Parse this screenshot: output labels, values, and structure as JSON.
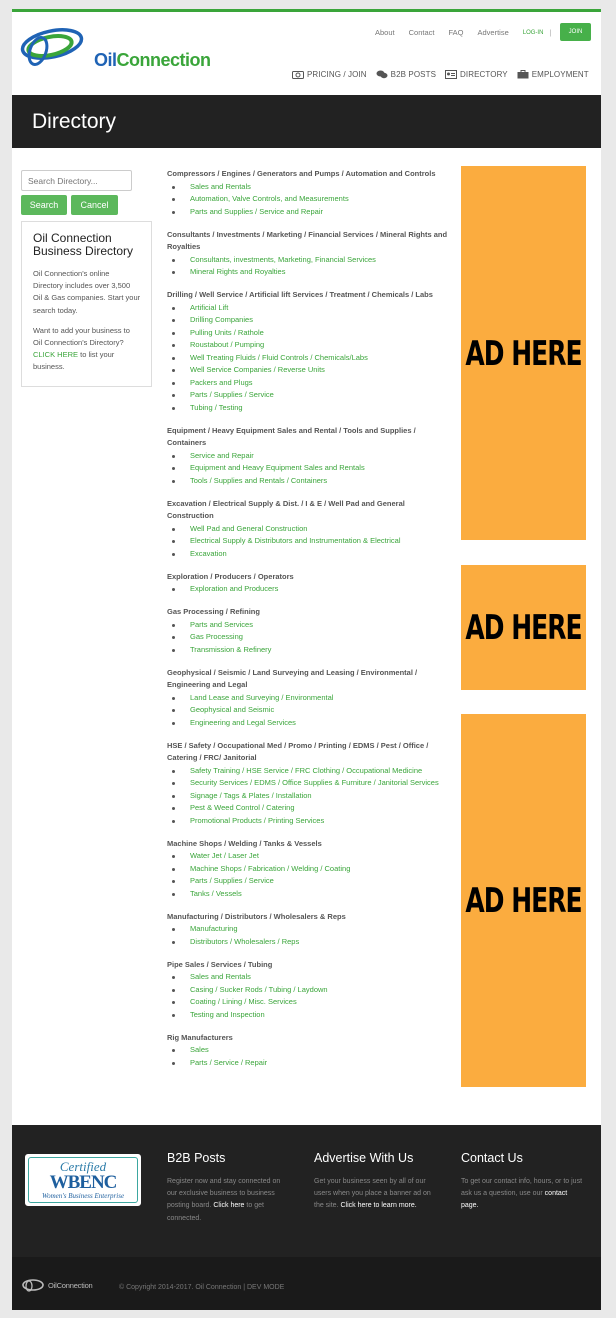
{
  "brand": {
    "logo_oil": "Oil",
    "logo_connection": "Connection",
    "brand_green": "#3aa53a",
    "brand_blue": "#1f63b5"
  },
  "topnav": {
    "about": "About",
    "contact": "Contact",
    "faq": "FAQ",
    "advertise": "Advertise",
    "login": "LOG-IN",
    "sep": "|",
    "join": "JOIN"
  },
  "mainnav": [
    {
      "label": "PRICING / JOIN",
      "icon": "camera-icon"
    },
    {
      "label": "B2B POSTS",
      "icon": "chat-icon"
    },
    {
      "label": "DIRECTORY",
      "icon": "id-card-icon"
    },
    {
      "label": "EMPLOYMENT",
      "icon": "briefcase-icon"
    }
  ],
  "page_title": "Directory",
  "search": {
    "placeholder": "Search Directory...",
    "search_label": "Search",
    "cancel_label": "Cancel"
  },
  "infobox": {
    "title": "Oil Connection Business Directory",
    "p1": "Oil Connection's online Directory includes over 3,500 Oil & Gas companies. Start your search today.",
    "p2_before": "Want to add your business to Oil Connection's Directory?",
    "p2_link": "CLICK HERE",
    "p2_after": "to list your business."
  },
  "categories": [
    {
      "title": "Compressors / Engines / Generators and Pumps / Automation and Controls",
      "items": [
        "Sales and Rentals",
        "Automation, Valve Controls, and Measurements",
        "Parts and Supplies / Service and Repair"
      ]
    },
    {
      "title": "Consultants / Investments / Marketing / Financial Services / Mineral Rights and Royalties",
      "items": [
        "Consultants, investments, Marketing, Financial Services",
        "Mineral Rights and Royalties"
      ]
    },
    {
      "title": "Drilling / Well Service / Artificial lift Services / Treatment / Chemicals / Labs",
      "items": [
        "Artificial Lift",
        "Drilling Companies",
        "Pulling Units / Rathole",
        "Roustabout / Pumping",
        "Well Treating Fluids / Fluid Controls / Chemicals/Labs",
        "Well Service Companies / Reverse Units",
        "Packers and Plugs",
        "Parts / Supplies / Service",
        "Tubing / Testing"
      ]
    },
    {
      "title": "Equipment / Heavy Equipment Sales and Rental / Tools and Supplies / Containers",
      "items": [
        "Service and Repair",
        "Equipment and Heavy Equipment Sales and Rentals",
        "Tools / Supplies and Rentals / Containers"
      ]
    },
    {
      "title": "Excavation / Electrical Supply & Dist. / I & E / Well Pad and General Construction",
      "items": [
        "Well Pad and General Construction",
        "Electrical Supply & Distributors and Instrumentation & Electrical",
        "Excavation"
      ]
    },
    {
      "title": "Exploration / Producers / Operators",
      "items": [
        "Exploration and Producers"
      ]
    },
    {
      "title": "Gas Processing / Refining",
      "items": [
        "Parts and Services",
        "Gas Processing",
        "Transmission & Refinery"
      ]
    },
    {
      "title": "Geophysical / Seismic / Land Surveying and Leasing / Environmental / Engineering and Legal",
      "items": [
        "Land Lease and Surveying / Environmental",
        "Geophysical and Seismic",
        "Engineering and Legal Services"
      ]
    },
    {
      "title": "HSE / Safety / Occupational Med / Promo / Printing / EDMS / Pest / Office / Catering / FRC/ Janitorial",
      "items": [
        "Safety Training / HSE Service / FRC Clothing / Occupational Medicine",
        "Security Services / EDMS / Office Supplies & Furniture / Janitorial Services",
        "Signage / Tags & Plates / Installation",
        "Pest & Weed Control / Catering",
        "Promotional Products / Printing Services"
      ]
    },
    {
      "title": "Machine Shops / Welding / Tanks & Vessels",
      "items": [
        "Water Jet / Laser Jet",
        "Machine Shops / Fabrication / Welding / Coating",
        "Parts / Supplies / Service",
        "Tanks / Vessels"
      ]
    },
    {
      "title": "Manufacturing / Distributors / Wholesalers & Reps",
      "items": [
        "Manufacturing",
        "Distributors / Wholesalers / Reps"
      ]
    },
    {
      "title": "Pipe Sales / Services / Tubing",
      "items": [
        "Sales and Rentals",
        "Casing / Sucker Rods / Tubing / Laydown",
        "Coating / Lining / Misc. Services",
        "Testing and Inspection"
      ]
    },
    {
      "title": "Rig Manufacturers",
      "items": [
        "Sales",
        "Parts / Service / Repair"
      ]
    }
  ],
  "ads": {
    "label": "AD HERE",
    "color": "#fbac3f"
  },
  "footer": {
    "wbenc": {
      "certified": "Certified",
      "name": "WBENC",
      "sub": "Women's Business Enterprise"
    },
    "b2b": {
      "title": "B2B Posts",
      "text": "Register now and stay connected on our exclusive business to business posting board.",
      "link": "Click here",
      "after": "to get connected."
    },
    "advertise": {
      "title": "Advertise With Us",
      "text": "Get your business seen by all of our users when you place a banner ad on the site.",
      "link": "Click here to learn more."
    },
    "contact": {
      "title": "Contact Us",
      "text": "To get our contact info, hours, or to just ask us a question, use our",
      "link": "contact page."
    }
  },
  "bottom": {
    "logo": "OilConnection",
    "copyright": "© Copyright 2014-2017.   Oil Connection   |   DEV MODE"
  }
}
